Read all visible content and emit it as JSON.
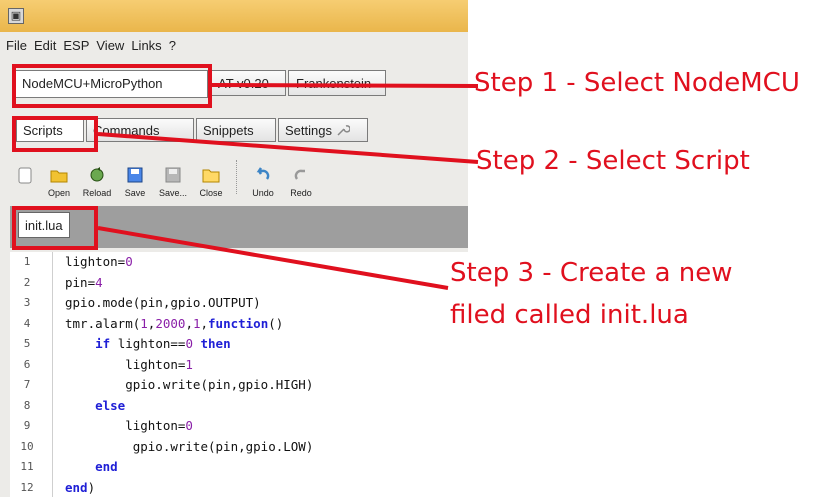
{
  "menu": [
    "File",
    "Edit",
    "ESP",
    "View",
    "Links",
    "?"
  ],
  "platform_tabs": [
    "NodeMCU+MicroPython",
    "AT v0.20",
    "Frankenstein"
  ],
  "section_tabs": [
    "Scripts",
    "Commands",
    "Snippets",
    "Settings"
  ],
  "toolbar": {
    "open": "Open",
    "reload": "Reload",
    "save": "Save",
    "save_as": "Save...",
    "close": "Close",
    "undo": "Undo",
    "redo": "Redo"
  },
  "file_tab": "init.lua",
  "editor": {
    "line_numbers": [
      "1",
      "2",
      "3",
      "4",
      "5",
      "6",
      "7",
      "8",
      "9",
      "10",
      "11",
      "12"
    ],
    "lines": [
      "lighton=0",
      "pin=4",
      "gpio.mode(pin,gpio.OUTPUT)",
      "tmr.alarm(1,2000,1,function()",
      "    if lighton==0 then",
      "        lighton=1",
      "        gpio.write(pin,gpio.HIGH)",
      "    else",
      "        lighton=0",
      "         gpio.write(pin,gpio.LOW)",
      "    end",
      "end)"
    ]
  },
  "annotations": {
    "step1": "Step 1 - Select NodeMCU",
    "step2": "Step 2 - Select Script",
    "step3_line1": "Step 3 - Create a new",
    "step3_line2": "filed called init.lua"
  },
  "colors": {
    "annotation_red": "#e0101e",
    "titlebar": "#eab64b",
    "keyword_blue": "#1f1fd6",
    "number_purple": "#8a1fa8"
  }
}
